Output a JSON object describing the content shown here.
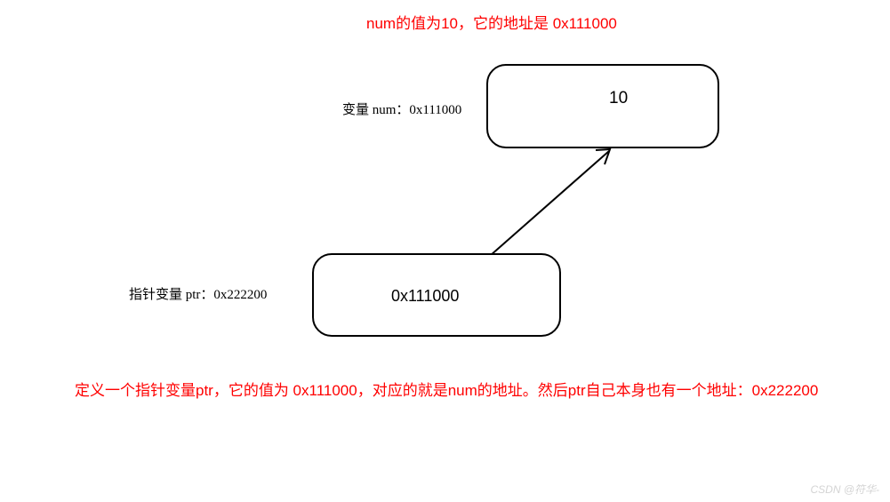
{
  "explanation_top": "num的值为10，它的地址是 0x111000",
  "num": {
    "label": "变量 num：0x111000",
    "value": "10",
    "address": "0x111000"
  },
  "ptr": {
    "label": "指针变量 ptr：0x222200",
    "value": "0x111000",
    "address": "0x222200"
  },
  "explanation_bottom": "定义一个指针变量ptr，它的值为 0x111000，对应的就是num的地址。然后ptr自己本身也有一个地址：0x222200",
  "watermark": "CSDN @符华-",
  "colors": {
    "explanation": "#ff0000",
    "box_border": "#000000",
    "arrow": "#000000"
  }
}
